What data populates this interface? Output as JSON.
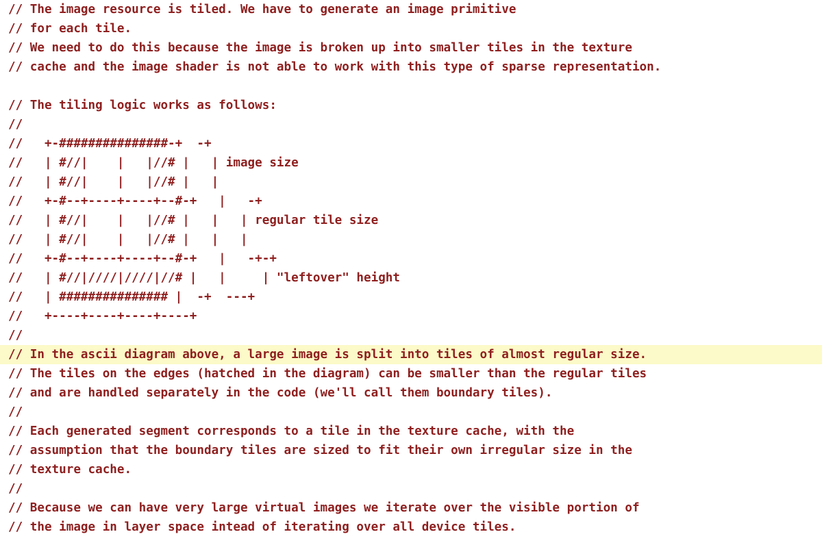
{
  "editor": {
    "name": "code-comment-viewer",
    "background_color": "#ffffff",
    "comment_color": "#8f1f1f",
    "highlight_color": "#fcfac8",
    "font_size_px": 17.6,
    "line_height_px": 28,
    "highlighted_line_index": 18
  },
  "lines": [
    {
      "text": "// The image resource is tiled. We have to generate an image primitive",
      "highlighted": false
    },
    {
      "text": "// for each tile.",
      "highlighted": false
    },
    {
      "text": "// We need to do this because the image is broken up into smaller tiles in the texture",
      "highlighted": false
    },
    {
      "text": "// cache and the image shader is not able to work with this type of sparse representation.",
      "highlighted": false
    },
    {
      "text": "",
      "highlighted": false
    },
    {
      "text": "// The tiling logic works as follows:",
      "highlighted": false
    },
    {
      "text": "//",
      "highlighted": false
    },
    {
      "text": "//   +-###############-+  -+",
      "highlighted": false
    },
    {
      "text": "//   | #//|    |   |//# |   | image size",
      "highlighted": false
    },
    {
      "text": "//   | #//|    |   |//# |   |",
      "highlighted": false
    },
    {
      "text": "//   +-#--+----+----+--#-+   |   -+",
      "highlighted": false
    },
    {
      "text": "//   | #//|    |   |//# |   |   | regular tile size",
      "highlighted": false
    },
    {
      "text": "//   | #//|    |   |//# |   |   |",
      "highlighted": false
    },
    {
      "text": "//   +-#--+----+----+--#-+   |   -+-+",
      "highlighted": false
    },
    {
      "text": "//   | #//|////|////|//# |   |     | \"leftover\" height",
      "highlighted": false
    },
    {
      "text": "//   | ############### |  -+  ---+",
      "highlighted": false
    },
    {
      "text": "//   +----+----+----+----+",
      "highlighted": false
    },
    {
      "text": "//",
      "highlighted": false
    },
    {
      "text": "// In the ascii diagram above, a large image is split into tiles of almost regular size.",
      "highlighted": true
    },
    {
      "text": "// The tiles on the edges (hatched in the diagram) can be smaller than the regular tiles",
      "highlighted": false
    },
    {
      "text": "// and are handled separately in the code (we'll call them boundary tiles).",
      "highlighted": false
    },
    {
      "text": "//",
      "highlighted": false
    },
    {
      "text": "// Each generated segment corresponds to a tile in the texture cache, with the",
      "highlighted": false
    },
    {
      "text": "// assumption that the boundary tiles are sized to fit their own irregular size in the",
      "highlighted": false
    },
    {
      "text": "// texture cache.",
      "highlighted": false
    },
    {
      "text": "//",
      "highlighted": false
    },
    {
      "text": "// Because we can have very large virtual images we iterate over the visible portion of",
      "highlighted": false
    },
    {
      "text": "// the image in layer space intead of iterating over all device tiles.",
      "highlighted": false
    }
  ]
}
